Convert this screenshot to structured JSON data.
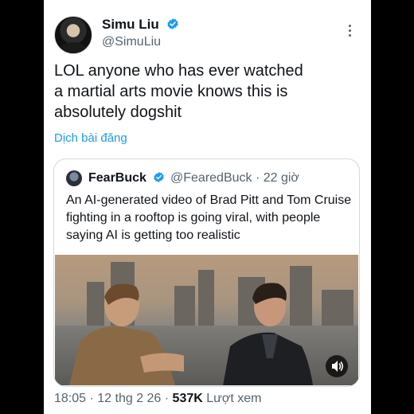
{
  "tweet": {
    "author_name": "Simu Liu",
    "author_handle": "@SimuLiu",
    "text": "LOL anyone who has ever watched\na martial arts movie knows this is\nabsolutely dogshit",
    "translate_label": "Dịch bài đăng",
    "time": "18:05 · 12 thg 2 26 · ",
    "views_count": "537K",
    "views_label": " Lượt xem"
  },
  "quote": {
    "author_name": "FearBuck",
    "author_handle": "@FearedBuck · 22 giờ",
    "text": "An AI-generated video of Brad Pitt and Tom Cruise fighting in a rooftop is going viral, with people saying AI is getting too realistic"
  },
  "colors": {
    "verified": "#1d9bf0",
    "link": "#1d9bf0",
    "secondary_text": "#536471",
    "primary_text": "#0f1419"
  },
  "icons": [
    "verified-badge-icon",
    "more-options-icon",
    "sound-icon"
  ]
}
